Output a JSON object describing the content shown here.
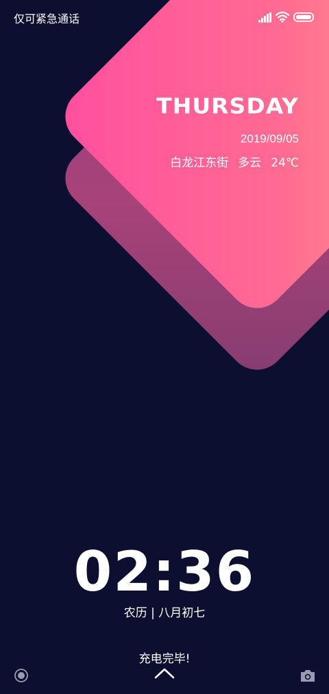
{
  "status_bar": {
    "carrier_text": "仅可紧急通话",
    "icons": [
      "signal-icon",
      "wifi-icon",
      "battery-icon"
    ]
  },
  "weather_panel": {
    "day": "THURSDAY",
    "date": "2019/09/05",
    "location": "白龙江东街",
    "condition": "多云",
    "temperature": "24℃"
  },
  "clock": {
    "time": "02:36",
    "lunar_date": "农历 | 八月初七"
  },
  "bottom": {
    "charge_status": "充电完毕!",
    "left_shortcut_icon": "record-icon",
    "right_shortcut_icon": "camera-icon",
    "unlock_icon": "chevron-up-icon"
  },
  "colors": {
    "background": "#0d0f30",
    "diamond_front_start": "#ff9e84",
    "diamond_front_end": "#ff4f9f",
    "diamond_back": "#a8427f",
    "text": "#ffffff"
  }
}
